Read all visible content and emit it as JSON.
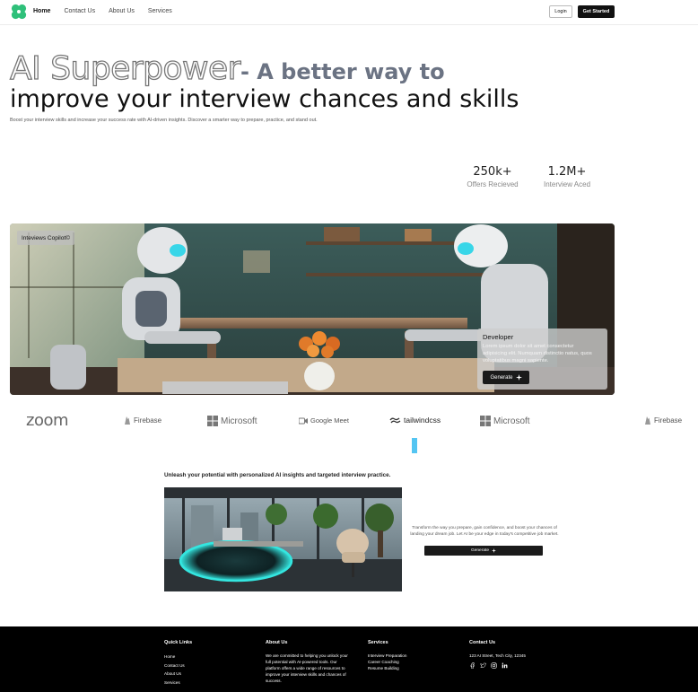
{
  "nav": {
    "links": [
      "Home",
      "Contact Us",
      "About Us",
      "Services"
    ],
    "active": "Home",
    "login": "Login",
    "get_started": "Get Started"
  },
  "hero": {
    "title_outline": "AI Superpower",
    "title_bold": "- A better way to",
    "title_line2": "improve your interview chances and skills",
    "subtitle": "Boost your interview skills and increase your success rate with AI-driven insights. Discover a smarter way to prepare, practice, and stand out."
  },
  "stats": [
    {
      "value": "250k+",
      "label": "Offers Recieved"
    },
    {
      "value": "1.2M+",
      "label": "Interview Aced"
    }
  ],
  "banner": {
    "badge": "Inteviews Copilot©",
    "card_title": "Developer",
    "card_text": "Lorem ipsum dolor sit amet consectetur adipisicing elit. Numquam distinctio natus, quos voluptatibus magni sapiente.",
    "card_button": "Generate"
  },
  "logos": [
    "zoom",
    "Firebase",
    "Microsoft",
    "Google Meet",
    "tailwindcss",
    "Microsoft",
    "Firebase"
  ],
  "feature": {
    "title": "Unleash your potential with personalized AI insights and targeted interview practice.",
    "description": "Transform the way you prepare, gain confidence, and boost your chances of landing your dream job. Let AI be your edge in today's competitive job market.",
    "button": "Generate"
  },
  "footer": {
    "quick_links": {
      "title": "Quick Links",
      "items": [
        "Home",
        "Contact Us",
        "About Us",
        "Services"
      ]
    },
    "about": {
      "title": "About Us",
      "text": "We are committed to helping you unlock your full potential with AI-powered tools. Our platform offers a wide range of resources to improve your interview skills and chances of success."
    },
    "services": {
      "title": "Services",
      "items": [
        "Interview Preparation",
        "Career Coaching",
        "Resume Building"
      ]
    },
    "contact": {
      "title": "Contact Us",
      "address": "123 AI Street, Tech City, 12345",
      "socials": [
        "facebook-icon",
        "twitter-icon",
        "instagram-icon",
        "linkedin-icon"
      ]
    }
  },
  "colors": {
    "accent_dark": "#1a1a1a",
    "logo_green": "#2fc07a",
    "hero_bold": "#6b7383",
    "highlight_blue": "#54c5f2"
  }
}
